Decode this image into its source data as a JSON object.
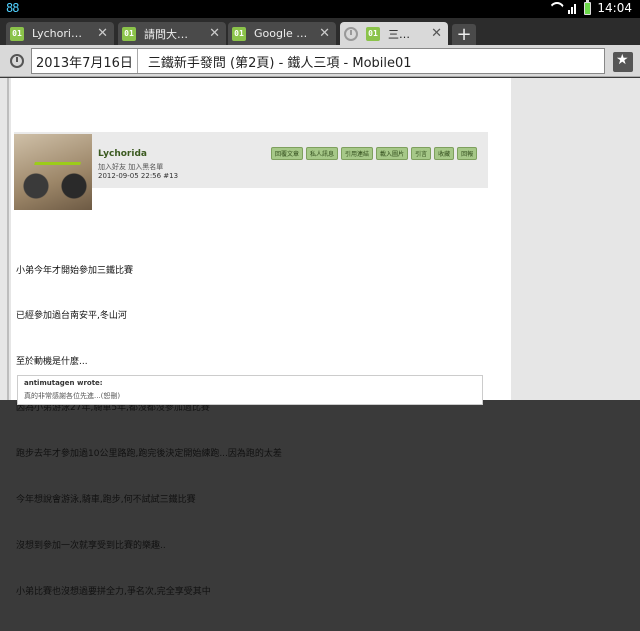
{
  "status_bar": {
    "left_indicator": "88",
    "time": "14:04"
  },
  "tabs": [
    {
      "label": "Lychori…",
      "icon": "mobile01-favicon"
    },
    {
      "label": "請問大…",
      "icon": "mobile01-favicon"
    },
    {
      "label": "Google …",
      "icon": "mobile01-favicon"
    },
    {
      "label": "三…",
      "icon": "mobile01-favicon",
      "active": true
    }
  ],
  "new_tab_label": "+",
  "address_bar": {
    "date": "2013年7月16日",
    "title": "三鐵新手發問 (第2頁) - 鐵人三項 - Mobile01"
  },
  "post": {
    "username": "Lychorida",
    "user_links": "加入好友  加入黑名單",
    "meta": "2012-09-05 22:56  #13",
    "actions": [
      "回覆文章",
      "私人訊息",
      "引用連結",
      "載入圖片",
      "引言",
      "收藏",
      "回報"
    ],
    "body": [
      "小弟今年才開始參加三鐵比賽",
      "已經參加過台南安平,冬山河",
      "至於動機是什麼...",
      "因為小弟游泳27年,騎車5年,都沒都沒參加過比賽",
      "跑步去年才參加過10公里路跑,跑完後決定開始練跑...因為跑的太差",
      "今年想說會游泳,騎車,跑步,何不試試三鐵比賽",
      "沒想到參加一次就享受到比賽的樂趣..",
      "小弟比賽也沒想過要拼全力,爭名次,完全享受其中"
    ],
    "quote": {
      "author": "antimutagen wrote:",
      "text": "真的非常感謝各位先進...(恕刪)"
    }
  },
  "colors": {
    "accent_green": "#a6c888",
    "status_battery": "#6cd84a"
  }
}
